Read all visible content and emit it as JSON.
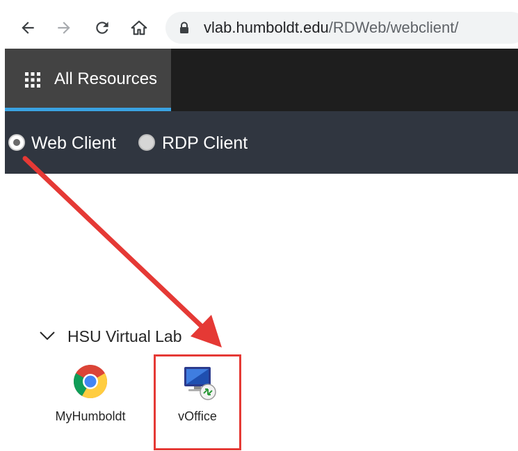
{
  "browser": {
    "url_host": "vlab.humboldt.edu",
    "url_path": "/RDWeb/webclient/",
    "icons": [
      "back-arrow-icon",
      "forward-arrow-icon",
      "reload-icon",
      "home-icon",
      "lock-icon"
    ]
  },
  "appbar": {
    "tab_label": "All Resources",
    "accent_color": "#3aa3e3",
    "background": "#1e1e1e"
  },
  "client_switch": {
    "options": [
      {
        "label": "Web Client",
        "selected": true
      },
      {
        "label": "RDP Client",
        "selected": false
      }
    ]
  },
  "collection": {
    "title": "HSU Virtual Lab",
    "apps": [
      {
        "name": "MyHumboldt",
        "icon": "chrome-icon"
      },
      {
        "name": "vOffice",
        "icon": "remote-desktop-icon"
      }
    ]
  },
  "annotation": {
    "color": "#e53935"
  }
}
